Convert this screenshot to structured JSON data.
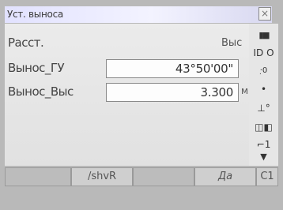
{
  "window": {
    "title": "Уст. выноса",
    "close_glyph": "×"
  },
  "form": {
    "rows": [
      {
        "label": "Расст.",
        "value": "Выс",
        "unit": ""
      },
      {
        "label": "Вынос_ГУ",
        "value": "43°50'00\"",
        "unit": ""
      },
      {
        "label": "Вынос_Выс",
        "value": "3.300",
        "unit": "м"
      }
    ]
  },
  "sidebar": {
    "icons": [
      {
        "name": "battery-icon",
        "glyph": "▮▮▮"
      },
      {
        "name": "hv-readout-icon",
        "glyph": "ID  O"
      },
      {
        "name": "prism-constant-icon",
        "glyph": "·̣0"
      },
      {
        "name": "dot-icon",
        "glyph": "•"
      },
      {
        "name": "level-icon",
        "glyph": "⊥°"
      },
      {
        "name": "target-icon",
        "glyph": "◫◧"
      },
      {
        "name": "page-indicator-icon",
        "glyph": "⌐1"
      },
      {
        "name": "signal-icon",
        "glyph": "▼"
      }
    ]
  },
  "softkeys": [
    {
      "label": ""
    },
    {
      "label": "/shvR"
    },
    {
      "label": ""
    },
    {
      "label": "Да"
    },
    {
      "label": "С1"
    }
  ]
}
